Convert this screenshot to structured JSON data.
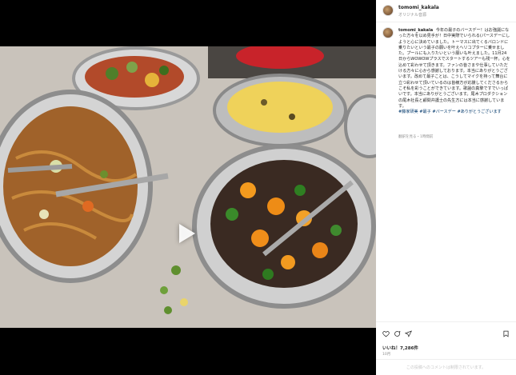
{
  "post": {
    "username": "tomomi_kakala",
    "audio": "オリジナル音源",
    "caption_user": "tomomi_kakala",
    "caption_text": "今年の最子のバースデー！はお強誕になった方々を以め見手が！日中実際でいられる(パースデーにしようと心に決めていました。トーマスに出てくるバロンドに乗りたいという最子の願いを叶えヘリコプターに乗せました。プールにも入りたいという願いも叶えました。11月24日からWOWOWプラスでスタートするツアーも残一杯。心を込めて彩わせて頂きます。ファンの皆さまや仕事していただける方々に心から感謝しております。本当にありがとうございます。改めて最子ことは、こうしてマイクを持って舞台に立つ彩わせて頂いているのは皆様方が応援してくださるからこそ私を彩うことができています。歌謡の真摯ですでいっぱいです。本当にありがとうございます。尾木プロダクションの尾木社長と顧問弁護士の先生方には本当に感謝しています。",
    "hashtags": "#藤家研美 #最子 #バースデー #ありがとうございます",
    "translate": "翻訳を見る・1時間前",
    "likes": "いいね！7,286件",
    "date": "10月",
    "comment_placeholder": "この投稿へのコメントは制限されています。"
  },
  "icons": {
    "heart": "heart-icon",
    "comment": "comment-icon",
    "share": "share-icon",
    "save": "bookmark-icon",
    "play": "play-icon",
    "mute": "mute-icon"
  },
  "colors": {
    "link": "#00376b",
    "muted": "#8e8e8e"
  }
}
